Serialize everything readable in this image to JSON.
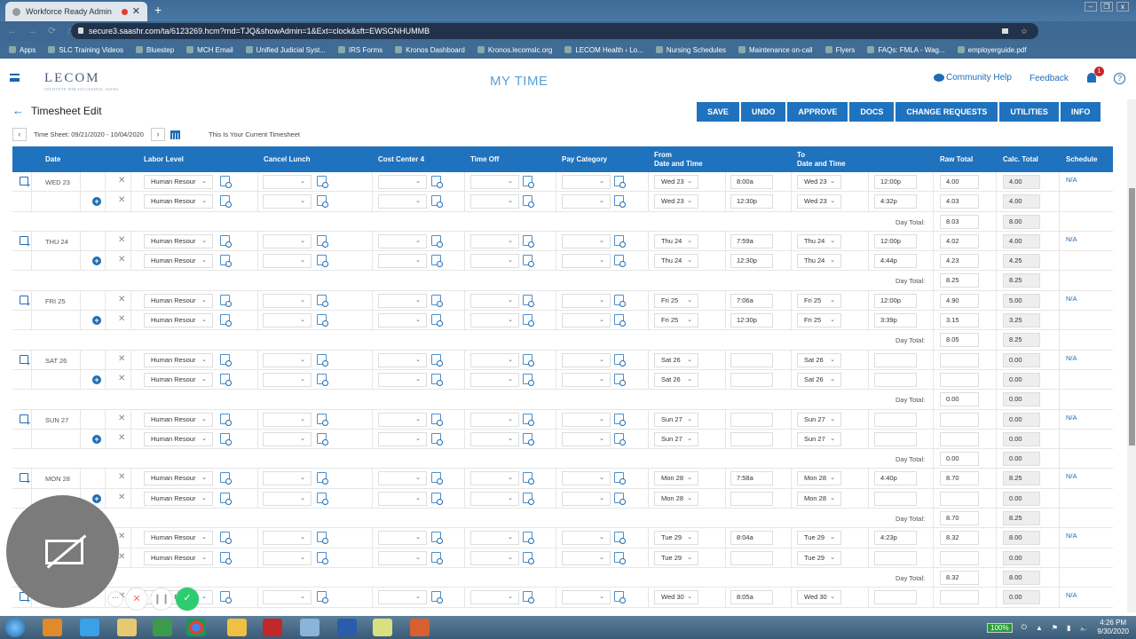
{
  "browser": {
    "tab_title": "Workforce Ready Admin",
    "url": "secure3.saashr.com/ta/6123269.hcm?rnd=TJQ&showAdmin=1&Ext=clock&sft=EWSGNHUMMB",
    "bookmarks": [
      "Apps",
      "SLC Training Videos",
      "Bluestep",
      "MCH Email",
      "Unified Judicial Syst...",
      "IRS Forms",
      "Kronos Dashboard",
      "Kronos.lecomslc.org",
      "LECOM Health ‹ Lo...",
      "Nursing Schedules",
      "Maintenance on-call",
      "Flyers",
      "FAQs: FMLA - Wag...",
      "employerguide.pdf"
    ]
  },
  "header": {
    "logo": "LECOM",
    "logo_sub": "INSTITUTE FOR SUCCESSFUL AGING",
    "title": "MY TIME",
    "community_help": "Community Help",
    "feedback": "Feedback",
    "notification_count": "1",
    "help": "?"
  },
  "page": {
    "title": "Timesheet Edit",
    "timesheet_range": "Time Sheet: 09/21/2020 - 10/04/2020",
    "current_label": "This Is Your Current Timesheet",
    "actions": [
      "SAVE",
      "UNDO",
      "APPROVE",
      "DOCS",
      "CHANGE REQUESTS",
      "UTILITIES",
      "INFO"
    ]
  },
  "columns": {
    "date": "Date",
    "labor_level": "Labor Level",
    "cancel_lunch": "Cancel Lunch",
    "cost_center": "Cost Center 4",
    "time_off": "Time Off",
    "pay_category": "Pay Category",
    "from_1": "From",
    "from_2": "Date and Time",
    "to_1": "To",
    "to_2": "Date and Time",
    "raw_total": "Raw Total",
    "calc_total": "Calc. Total",
    "schedule": "Schedule"
  },
  "day_total_label": "Day Total:",
  "days": [
    {
      "label": "WED 23",
      "date": "Wed 23",
      "schedule": "N/A",
      "entries": [
        {
          "labor": "Human Resour",
          "from_time": "8:00a",
          "to_time": "12:00p",
          "raw": "4.00",
          "calc": "4.00"
        },
        {
          "labor": "Human Resour",
          "from_time": "12:30p",
          "to_time": "4:32p",
          "raw": "4.03",
          "calc": "4.00"
        }
      ],
      "raw_total": "8.03",
      "calc_total": "8.00"
    },
    {
      "label": "THU 24",
      "date": "Thu 24",
      "schedule": "N/A",
      "entries": [
        {
          "labor": "Human Resour",
          "from_time": "7:59a",
          "to_time": "12:00p",
          "raw": "4.02",
          "calc": "4.00"
        },
        {
          "labor": "Human Resour",
          "from_time": "12:30p",
          "to_time": "4:44p",
          "raw": "4.23",
          "calc": "4.25"
        }
      ],
      "raw_total": "8.25",
      "calc_total": "8.25"
    },
    {
      "label": "FRI 25",
      "date": "Fri 25",
      "schedule": "N/A",
      "entries": [
        {
          "labor": "Human Resour",
          "from_time": "7:06a",
          "to_time": "12:00p",
          "raw": "4.90",
          "calc": "5.00"
        },
        {
          "labor": "Human Resour",
          "from_time": "12:30p",
          "to_time": "3:39p",
          "raw": "3.15",
          "calc": "3.25"
        }
      ],
      "raw_total": "8.05",
      "calc_total": "8.25"
    },
    {
      "label": "SAT 26",
      "date": "Sat 26",
      "schedule": "N/A",
      "entries": [
        {
          "labor": "Human Resour",
          "from_time": "",
          "to_time": "",
          "raw": "",
          "calc": "0.00"
        },
        {
          "labor": "Human Resour",
          "from_time": "",
          "to_time": "",
          "raw": "",
          "calc": "0.00"
        }
      ],
      "raw_total": "0.00",
      "calc_total": "0.00"
    },
    {
      "label": "SUN 27",
      "date": "Sun 27",
      "schedule": "N/A",
      "entries": [
        {
          "labor": "Human Resour",
          "from_time": "",
          "to_time": "",
          "raw": "",
          "calc": "0.00"
        },
        {
          "labor": "Human Resour",
          "from_time": "",
          "to_time": "",
          "raw": "",
          "calc": "0.00"
        }
      ],
      "raw_total": "0.00",
      "calc_total": "0.00"
    },
    {
      "label": "MON 28",
      "date": "Mon 28",
      "schedule": "N/A",
      "entries": [
        {
          "labor": "Human Resour",
          "from_time": "7:58a",
          "to_time": "4:40p",
          "raw": "8.70",
          "calc": "8.25"
        },
        {
          "labor": "Human Resour",
          "from_time": "",
          "to_time": "",
          "raw": "",
          "calc": "0.00"
        }
      ],
      "raw_total": "8.70",
      "calc_total": "8.25"
    },
    {
      "label": "TUE 29",
      "date": "Tue 29",
      "schedule": "N/A",
      "entries": [
        {
          "labor": "Human Resour",
          "from_time": "8:04a",
          "to_time": "4:23p",
          "raw": "8.32",
          "calc": "8.00"
        },
        {
          "labor": "Human Resour",
          "from_time": "",
          "to_time": "",
          "raw": "",
          "calc": "0.00"
        }
      ],
      "raw_total": "8.32",
      "calc_total": "8.00"
    },
    {
      "label": "WED 30",
      "date": "Wed 30",
      "schedule": "N/A",
      "entries": [
        {
          "labor": "Human Resour",
          "from_time": "8:05a",
          "to_time": "",
          "raw": "",
          "calc": "0.00"
        }
      ],
      "raw_total": "",
      "calc_total": ""
    }
  ],
  "taskbar": {
    "battery": "100%",
    "time": "4:26 PM",
    "date": "9/30/2020"
  },
  "colors": {
    "accent": "#1f72bd",
    "link": "#1f6db5",
    "badge": "#c62828"
  }
}
